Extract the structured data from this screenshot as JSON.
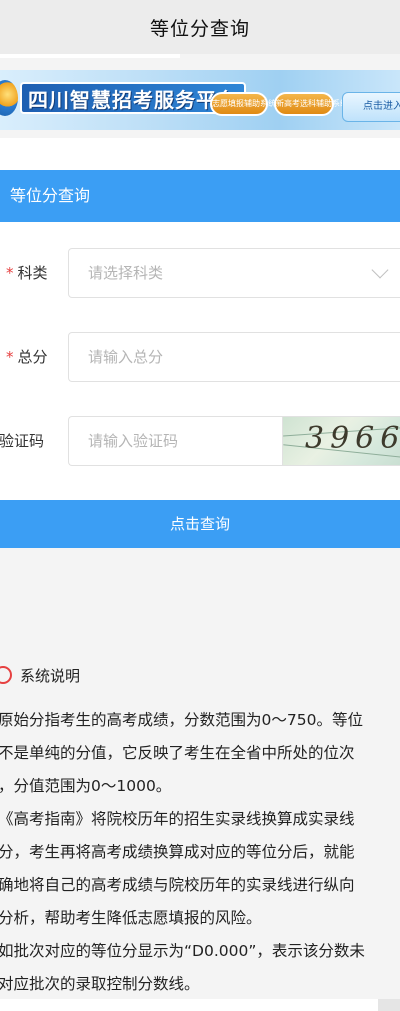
{
  "topbar": {
    "title": "等位分查询"
  },
  "banner": {
    "site_title": "四川智慧招考服务平台",
    "pill_one": "志愿填报辅助系统",
    "pill_two": "新高考选科辅助系统",
    "enter_label": "点击进入"
  },
  "section": {
    "title": "等位分查询"
  },
  "form": {
    "subject": {
      "label": "科类",
      "placeholder": "请选择科类"
    },
    "score": {
      "label": "总分",
      "placeholder": "请输入总分"
    },
    "captcha": {
      "label": "验证码",
      "placeholder": "请输入验证码",
      "code": "3966"
    }
  },
  "submit_label": "点击查询",
  "notes": {
    "title": "系统说明",
    "lines": [
      "原始分指考生的高考成绩，分数范围为0～750。等位",
      "不是单纯的分值，它反映了考生在全省中所处的位次",
      "，分值范围为0～1000。",
      "《高考指南》将院校历年的招生实录线换算成实录线",
      "分，考生再将高考成绩换算成对应的等位分后，就能",
      "确地将自己的高考成绩与院校历年的实录线进行纵向",
      "分析，帮助考生降低志愿填报的风险。",
      "如批次对应的等位分显示为“D0.000”，表示该分数未",
      "对应批次的录取控制分数线。"
    ]
  },
  "colors": {
    "primary": "#3b9ef4",
    "required_star": "#e64040"
  }
}
